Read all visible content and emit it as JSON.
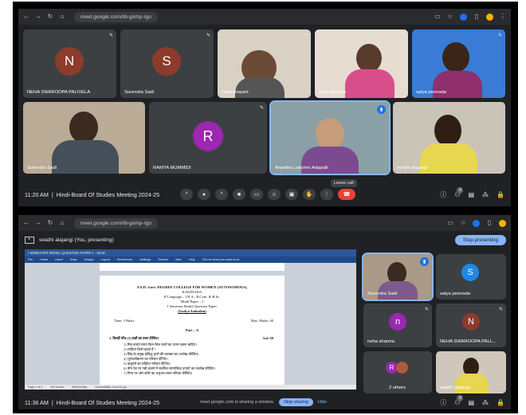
{
  "top": {
    "browser": {
      "url": "meet.google.com/rib-gomp-rgo"
    },
    "participants": [
      {
        "name": "NEHA SWAROOPA PALIVELA",
        "initial": "N",
        "color": "#8d3b2b"
      },
      {
        "name": "Surendra Sadi",
        "initial": "S",
        "color": "#8d3b2b"
      },
      {
        "name": "Daakshayani",
        "initial": "",
        "color": ""
      },
      {
        "name": "neha sharma",
        "initial": "",
        "color": ""
      },
      {
        "name": "satya pennada",
        "initial": "",
        "color": ""
      },
      {
        "name": "Surendra Sadi",
        "initial": "",
        "color": ""
      },
      {
        "name": "RAMYA MUMMIDI",
        "initial": "R",
        "color": "#9c27b0"
      },
      {
        "name": "Anantha Lakshmi Adapalli",
        "initial": "",
        "color": ""
      },
      {
        "name": "swathi alajangi",
        "initial": "",
        "color": ""
      }
    ],
    "time": "11:20 AM",
    "meeting_title": "Hindi-Board Of Studies Meeting 2024-25",
    "leave_tooltip": "Leave call",
    "participant_count": "9"
  },
  "bottom": {
    "browser": {
      "url": "meet.google.com/rib-gomp-rgo"
    },
    "presenter_label": "swathi alajangi (You, presenting)",
    "stop_presenting": "Stop presenting",
    "document": {
      "college": "A.S.D. Govt. DEGREE COLLEGE FOR WOMEN (AUTONOMOUS),",
      "city": "KAKINADA",
      "course": "II Language – I B.A., B.Com. & B.Sc.",
      "paper": "Hindi Paper – I",
      "exam": "I Semester Model Question Paper",
      "subject": "(Gadya Sankalan)",
      "time_label": "Time: 3 Hours",
      "marks_label": "Max. Marks: 60",
      "part": "Part – A",
      "question": "1.  किन्हीं पाँच (5) प्रश्नों का उत्तर दीजिए।",
      "marks_right": "5x4=20",
      "options": [
        "1) मित्र बनाते समय किन-किन बातों का ध्यान रखना चाहिए।",
        "2) साहित्य किसे कहते हैं ?",
        "3) सिंह के प्रमुख प्रसिद्ध गुणों की व्याख्या का उल्लेख कीजिए।",
        "4) भूमंडलीकरण का परिचय दीजिए।",
        "5) कबूतरों का संक्षिप्त परिचय दीजिए।",
        "6) नीम पेड़ पर पड़ी बचाने में संबंधित सामाजिक उपायों का उल्लेख कीजिए।",
        "7) निम्न पर ओर कोसे का अनुभव सरल परिचय कीजिए।"
      ],
      "word_title": "I SEMESTER MODEL QUESTION PAPER 1 - Word",
      "ribbon_items": [
        "File",
        "Home",
        "Insert",
        "Draw",
        "Design",
        "Layout",
        "References",
        "Mailings",
        "Review",
        "View",
        "Help",
        "Tell me what you want to do"
      ],
      "status_items": [
        "Page 1 of 2",
        "440 words",
        "Hindi (India)",
        "Accessibility: Good to go"
      ]
    },
    "participants": [
      {
        "name": "Surendra Sadi",
        "initial": "",
        "color": ""
      },
      {
        "name": "satya pennada",
        "initial": "S",
        "color": "#1e88e5"
      },
      {
        "name": "neha sharma",
        "initial": "n",
        "color": "#9c27b0"
      },
      {
        "name": "NEHA SWAROOPA PALL...",
        "initial": "N",
        "color": "#8d3b2b"
      },
      {
        "name": "2 others",
        "initial": "R",
        "color": "#9c27b0"
      },
      {
        "name": "swathi alajangi",
        "initial": "",
        "color": ""
      }
    ],
    "time": "11:36 AM",
    "meeting_title": "Hindi-Board Of Studies Meeting 2024-25",
    "share_notice": "meet.google.com is sharing a window.",
    "stop_sharing": "Stop sharing",
    "hide": "Hide",
    "participant_count": "9"
  },
  "icons": {
    "back": "arrow-left-icon",
    "forward": "arrow-right-icon",
    "reload": "reload-icon",
    "home": "home-icon",
    "pin": "pin-icon",
    "mic": "mic-icon",
    "camera": "camera-icon",
    "captions": "captions-icon",
    "emoji": "emoji-icon",
    "present": "present-icon",
    "raise_hand": "hand-icon",
    "more": "more-icon",
    "leave": "phone-icon"
  }
}
